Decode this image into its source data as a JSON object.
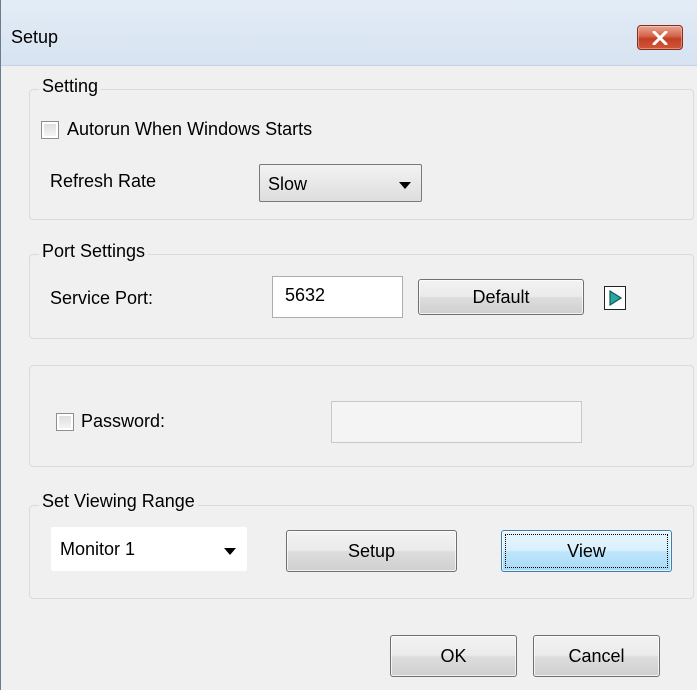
{
  "window": {
    "title": "Setup",
    "close_icon": "close-x-icon"
  },
  "setting": {
    "group_label": "Setting",
    "autorun_label": "Autorun When Windows Starts",
    "autorun_checked": false,
    "refresh_rate_label": "Refresh Rate",
    "refresh_rate_value": "Slow"
  },
  "port_settings": {
    "group_label": "Port Settings",
    "service_port_label": "Service Port:",
    "service_port_value": "5632",
    "default_button": "Default",
    "arrow_icon": "play-arrow-icon"
  },
  "password": {
    "label": "Password:",
    "checked": false,
    "value": ""
  },
  "viewing_range": {
    "group_label": "Set Viewing Range",
    "monitor_value": "Monitor 1",
    "setup_button": "Setup",
    "view_button": "View"
  },
  "footer": {
    "ok_button": "OK",
    "cancel_button": "Cancel"
  },
  "colors": {
    "dialog_bg": "#f0f0f0",
    "close_button": "#c94a30",
    "arrow_fill": "#2aa8a0"
  }
}
